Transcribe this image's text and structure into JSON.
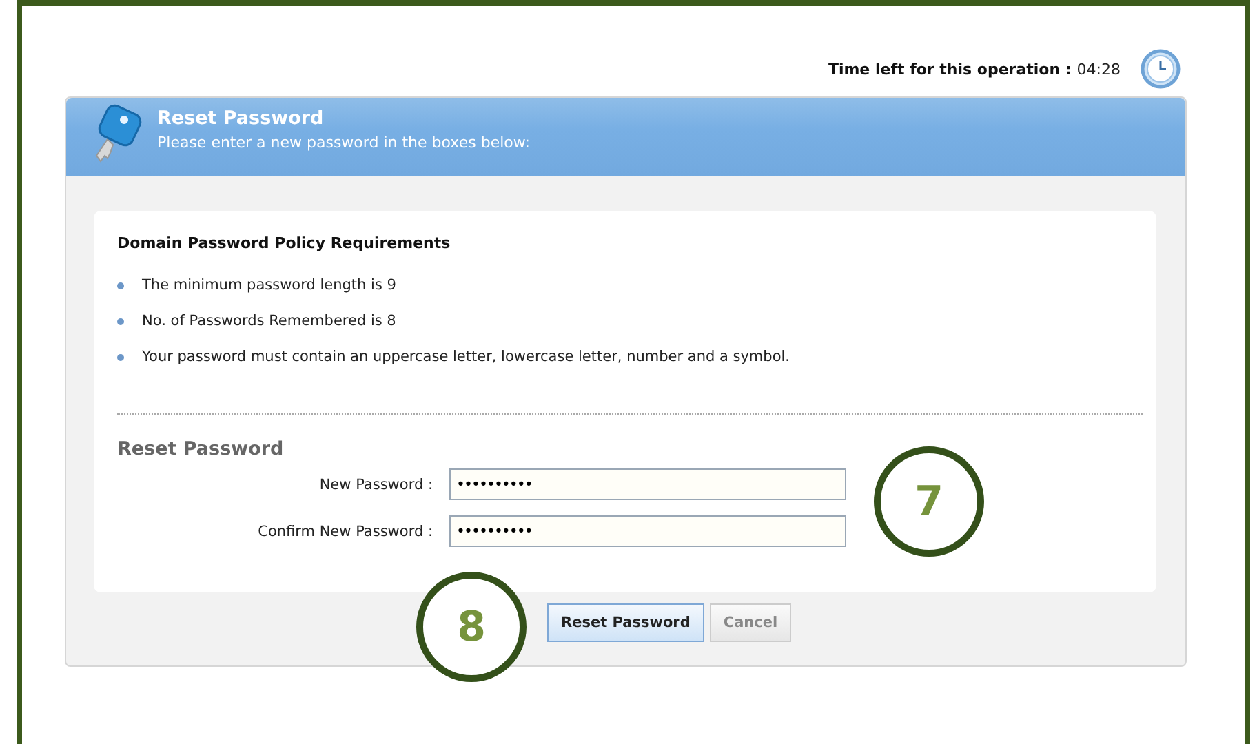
{
  "timer": {
    "label": "Time left for this operation :",
    "value": "04:28"
  },
  "header": {
    "title": "Reset Password",
    "subtitle": "Please enter a new password in the boxes below:"
  },
  "policy": {
    "title": "Domain Password Policy Requirements",
    "items": [
      "The minimum password length is 9",
      "No. of Passwords Remembered is 8",
      "Your password must contain an uppercase letter, lowercase letter, number and a symbol."
    ]
  },
  "form": {
    "title": "Reset Password",
    "fields": [
      {
        "label": "New Password :",
        "value": "••••••••••"
      },
      {
        "label": "Confirm New Password :",
        "value": "••••••••••"
      }
    ]
  },
  "buttons": [
    {
      "label": "Reset Password",
      "disabled": false
    },
    {
      "label": "Cancel",
      "disabled": true
    }
  ],
  "callouts": [
    {
      "number": "7"
    },
    {
      "number": "8"
    }
  ]
}
